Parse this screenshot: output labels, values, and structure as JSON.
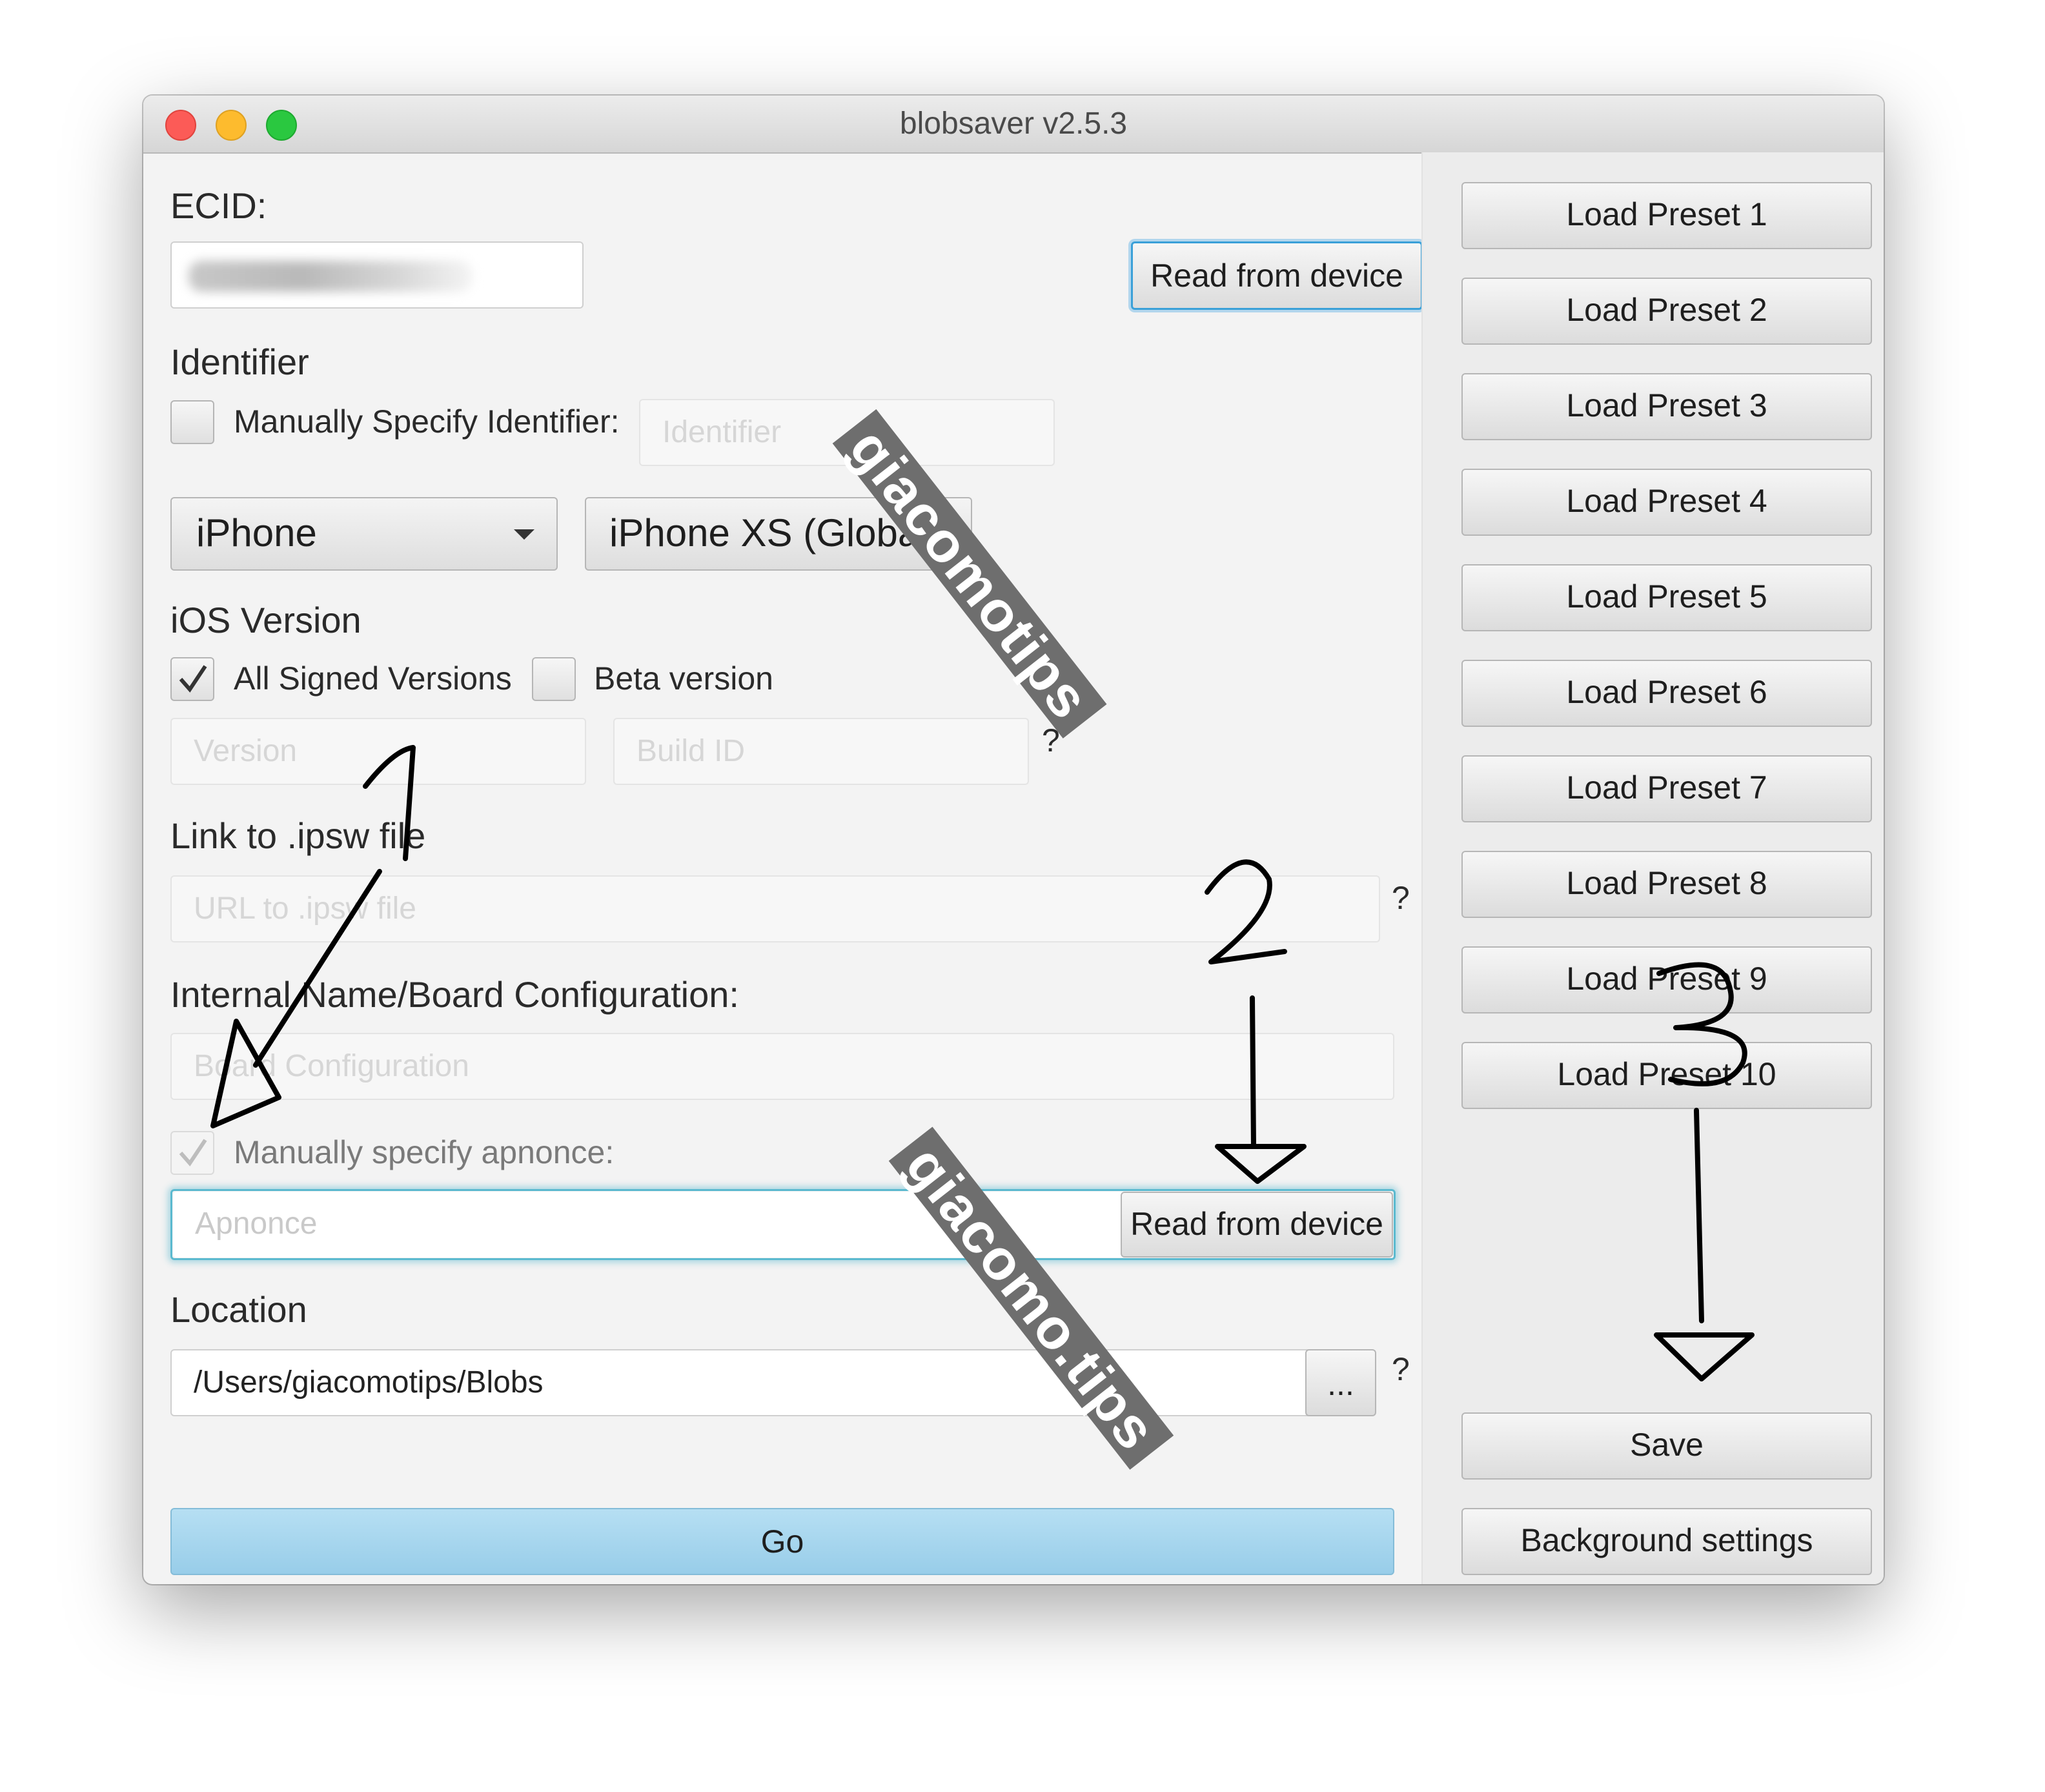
{
  "window": {
    "title": "blobsaver v2.5.3"
  },
  "ecid": {
    "label": "ECID:",
    "value": "",
    "read_button": "Read from device"
  },
  "identifier": {
    "section_label": "Identifier",
    "manual_checkbox_label": "Manually Specify Identifier:",
    "manual_checked": false,
    "identifier_placeholder": "Identifier"
  },
  "device": {
    "type_selected": "iPhone",
    "model_selected": "iPhone XS (Global..."
  },
  "ios_version": {
    "section_label": "iOS Version",
    "all_signed_label": "All Signed Versions",
    "all_signed_checked": true,
    "beta_label": "Beta version",
    "beta_checked": false,
    "version_placeholder": "Version",
    "build_id_placeholder": "Build ID",
    "help": "?"
  },
  "ipsw": {
    "section_label": "Link to .ipsw file",
    "url_placeholder": "URL to .ipsw file",
    "help": "?"
  },
  "board": {
    "section_label": "Internal Name/Board Configuration:",
    "placeholder": "Board Configuration"
  },
  "apnonce": {
    "checkbox_label": "Manually specify apnonce:",
    "checked": true,
    "placeholder": "Apnonce",
    "read_button": "Read from device"
  },
  "location": {
    "section_label": "Location",
    "path": "/Users/giacomotips/Blobs",
    "browse_button": "...",
    "help": "?"
  },
  "go_button": "Go",
  "presets": [
    {
      "label": "Load Preset 1"
    },
    {
      "label": "Load Preset 2"
    },
    {
      "label": "Load Preset 3"
    },
    {
      "label": "Load Preset 4"
    },
    {
      "label": "Load Preset 5"
    },
    {
      "label": "Load Preset 6"
    },
    {
      "label": "Load Preset 7"
    },
    {
      "label": "Load Preset 8"
    },
    {
      "label": "Load Preset 9"
    },
    {
      "label": "Load Preset 10"
    }
  ],
  "save_button": "Save",
  "background_settings_button": "Background settings",
  "watermarks": [
    "giacomotips",
    "giacomo.tips"
  ],
  "annotations": [
    "1",
    "2",
    "3"
  ],
  "colors": {
    "go_button": "#a6d6ef",
    "focus_blue": "#3aa0d8",
    "close": "#fc5b57",
    "minimize": "#fdbb2e",
    "maximize": "#2ac840"
  }
}
